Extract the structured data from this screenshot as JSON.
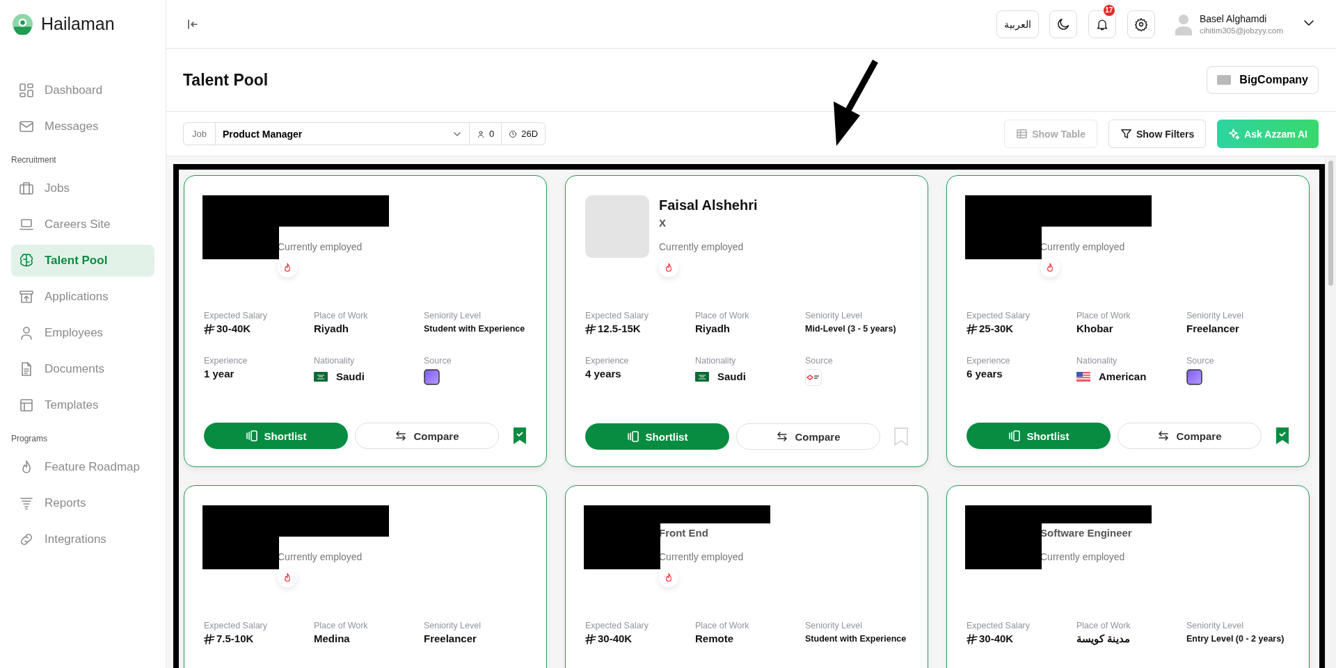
{
  "sidebar": {
    "brand": "Hailaman",
    "groups": [
      {
        "items": [
          {
            "label": "Dashboard",
            "selected": false
          },
          {
            "label": "Messages",
            "selected": false
          }
        ]
      },
      {
        "title": "Recruitment",
        "items": [
          {
            "label": "Jobs",
            "selected": false
          },
          {
            "label": "Careers Site",
            "selected": false
          },
          {
            "label": "Talent Pool",
            "selected": true
          },
          {
            "label": "Applications",
            "selected": false
          },
          {
            "label": "Employees",
            "selected": false
          },
          {
            "label": "Documents",
            "selected": false
          },
          {
            "label": "Templates",
            "selected": false
          }
        ]
      },
      {
        "title": "Programs",
        "items": [
          {
            "label": "Feature Roadmap",
            "selected": false
          },
          {
            "label": "Reports",
            "selected": false
          },
          {
            "label": "Integrations",
            "selected": false
          }
        ]
      }
    ]
  },
  "topbar": {
    "language": "العربية",
    "notifications": "17",
    "user": {
      "name": "Basel Alghamdi",
      "email": "cihitim305@jobzyy.com"
    }
  },
  "page": {
    "title": "Talent Pool",
    "company": "BigCompany"
  },
  "toolbar": {
    "job_filter": {
      "label": "Job",
      "value": "Product Manager",
      "applicants": "0",
      "age": "26D"
    },
    "actions": [
      {
        "label": "Show Table",
        "kind": "outline",
        "disabled": true
      },
      {
        "label": "Show Filters",
        "kind": "outline",
        "disabled": false
      },
      {
        "label": "Ask Azzam AI",
        "kind": "primary",
        "disabled": false
      }
    ]
  },
  "cards": [
    {
      "redacted": true,
      "status": "Currently employed",
      "hot": true,
      "fields": [
        {
          "label": "Expected Salary",
          "value": "30-40K",
          "kind": "currency"
        },
        {
          "label": "Place of Work",
          "value": "Riyadh",
          "kind": "text"
        },
        {
          "label": "Seniority Level",
          "value": "Student with Experience",
          "kind": "small"
        },
        {
          "label": "Experience",
          "value": "1 year",
          "kind": "text"
        },
        {
          "label": "Nationality",
          "value": "Saudi",
          "kind": "flag",
          "icon": {
            "kind": "sa"
          }
        },
        {
          "label": "Source",
          "kind": "source",
          "icon": {
            "kind": "tile"
          }
        }
      ],
      "shortlist": "Shortlist",
      "compare": "Compare",
      "saved": true
    },
    {
      "redacted": false,
      "name": "Faisal Alshehri",
      "headline": "X",
      "status": "Currently employed",
      "hot": true,
      "fields": [
        {
          "label": "Expected Salary",
          "value": "12.5-15K",
          "kind": "currency"
        },
        {
          "label": "Place of Work",
          "value": "Riyadh",
          "kind": "text"
        },
        {
          "label": "Seniority Level",
          "value": "Mid-Level (3 - 5 years)",
          "kind": "small"
        },
        {
          "label": "Experience",
          "value": "4 years",
          "kind": "text"
        },
        {
          "label": "Nationality",
          "value": "Saudi",
          "kind": "flag",
          "icon": {
            "kind": "sa"
          }
        },
        {
          "label": "Source",
          "kind": "source",
          "icon": {
            "kind": "logo"
          }
        }
      ],
      "shortlist": "Shortlist",
      "compare": "Compare",
      "saved": false
    },
    {
      "redacted": true,
      "status": "Currently employed",
      "hot": true,
      "fields": [
        {
          "label": "Expected Salary",
          "value": "25-30K",
          "kind": "currency"
        },
        {
          "label": "Place of Work",
          "value": "Khobar",
          "kind": "text"
        },
        {
          "label": "Seniority Level",
          "value": "Freelancer",
          "kind": "text"
        },
        {
          "label": "Experience",
          "value": "6 years",
          "kind": "text"
        },
        {
          "label": "Nationality",
          "value": "American",
          "kind": "flag",
          "icon": {
            "kind": "us"
          }
        },
        {
          "label": "Source",
          "kind": "source",
          "icon": {
            "kind": "tile"
          }
        }
      ],
      "shortlist": "Shortlist",
      "compare": "Compare",
      "saved": true
    },
    {
      "redacted": true,
      "status": "Currently employed",
      "hot": true,
      "fields": [
        {
          "label": "Expected Salary",
          "value": "7.5-10K",
          "kind": "currency"
        },
        {
          "label": "Place of Work",
          "value": "Medina",
          "kind": "text"
        },
        {
          "label": "Seniority Level",
          "value": "Freelancer",
          "kind": "text"
        }
      ]
    },
    {
      "redacted": true,
      "headline": "Front End",
      "status": "Currently employed",
      "hot": true,
      "fields": [
        {
          "label": "Expected Salary",
          "value": "30-40K",
          "kind": "currency"
        },
        {
          "label": "Place of Work",
          "value": "Remote",
          "kind": "text"
        },
        {
          "label": "Seniority Level",
          "value": "Student with Experience",
          "kind": "small"
        }
      ]
    },
    {
      "redacted": true,
      "headline": "Software Engineer",
      "status": "Currently employed",
      "hot": false,
      "fields": [
        {
          "label": "Expected Salary",
          "value": "30-40K",
          "kind": "currency"
        },
        {
          "label": "Place of Work",
          "value": "مدينة كويسة",
          "kind": "text"
        },
        {
          "label": "Seniority Level",
          "value": "Entry Level (0 - 2 years)",
          "kind": "small"
        }
      ]
    }
  ]
}
